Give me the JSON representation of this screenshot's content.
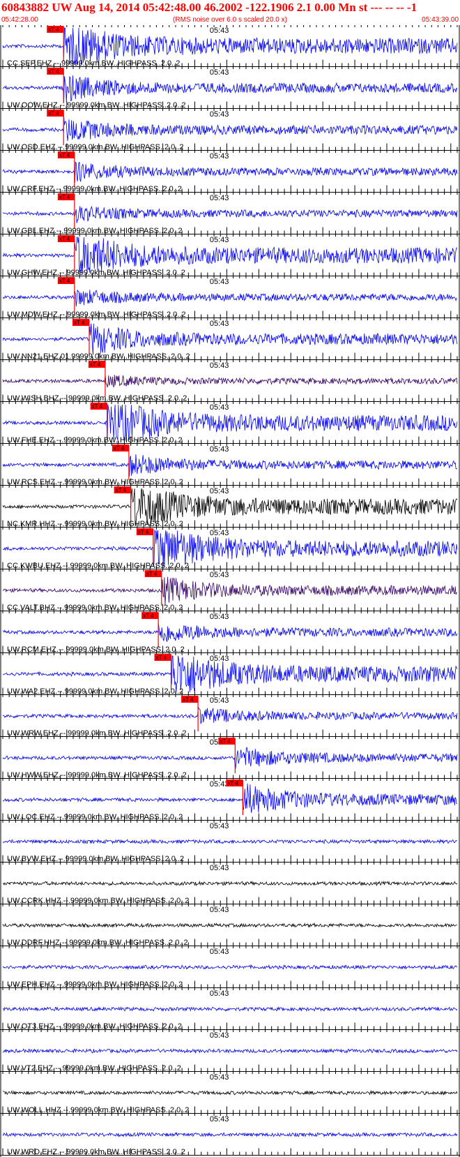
{
  "header": {
    "title": "60843882 UW Aug 14, 2014 05:42:48.00   46.2002 -122.1906  2.1 0.00 Mn st --- -- --  -1",
    "start_time": "05:42:28.00",
    "note": "(RMS noise over 6.0 s scaled 20.0 x)",
    "end_time": "05:43:39.00"
  },
  "colors": {
    "header": "#ff0000",
    "ehz_trace": "#0000ff",
    "bhz_trace": "#330066",
    "hhz_trace": "#000000",
    "pick": "#ff0000",
    "axis": "#000000"
  },
  "chart_data": {
    "type": "line",
    "x_range": [
      "05:42:28.00",
      "05:43:39.00"
    ],
    "minute_mark": "05:43",
    "pick_label": "xT 4",
    "traces": [
      {
        "label": "CC.SEP.EHZ.--.99999.0km.BW..HIGHPASS..2.0..2",
        "channel": "EHZ",
        "pick": 9.5,
        "amp": 1.0
      },
      {
        "label": "UW.OOW.EHZ.--.99999.0km.BW..HIGHPASS..2.0..2",
        "channel": "EHZ",
        "pick": 9.5,
        "amp": 0.5
      },
      {
        "label": "UW.OSD.EHZ.--.99999.0km.BW..HIGHPASS..2.0..2",
        "channel": "EHZ",
        "pick": 9.5,
        "amp": 0.45
      },
      {
        "label": "UW.CRF.EHZ.--.99999.0km.BW..HIGHPASS..2.0..2",
        "channel": "EHZ",
        "pick": 11.2,
        "amp": 0.35
      },
      {
        "label": "UW.GBL.EHZ.--.99999.0km.BW..HIGHPASS..2.0..2",
        "channel": "EHZ",
        "pick": 11.2,
        "amp": 0.3
      },
      {
        "label": "UW.GHW.EHZ.--.99999.0km.BW..HIGHPASS..2.0..2",
        "channel": "EHZ",
        "pick": 11.2,
        "amp": 1.0
      },
      {
        "label": "UW.MDW.EHZ.--.99999.0km.BW..HIGHPASS..2.0..2",
        "channel": "EHZ",
        "pick": 11.2,
        "amp": 0.3
      },
      {
        "label": "UW.NN21.EHZ.01.99999.0km.BW..HIGHPASS..2.0..2",
        "channel": "EHZ",
        "pick": 13.5,
        "amp": 0.6
      },
      {
        "label": "UW.WISH.BHZ.--.99999.0km.BW..HIGHPASS..2.0..2",
        "channel": "BHZ",
        "pick": 16.0,
        "amp": 0.2
      },
      {
        "label": "UW.FHE.EHZ.--.99999.0km.BW..HIGHPASS..2.0..2",
        "channel": "EHZ",
        "pick": 16.3,
        "amp": 1.0
      },
      {
        "label": "UW.RCS.EHZ.--.99999.0km.BW..HIGHPASS..2.0..2",
        "channel": "EHZ",
        "pick": 19.7,
        "amp": 0.4
      },
      {
        "label": "NC.KMR.HHZ.--.99999.0km.BW..HIGHPASS..2.0..2",
        "channel": "HHZ",
        "pick": 20.0,
        "amp": 1.0
      },
      {
        "label": "CC.KWBU.EHZ.--.99999.0km.BW..HIGHPASS..2.0..2",
        "channel": "EHZ",
        "pick": 23.5,
        "amp": 1.0
      },
      {
        "label": "CC.VALT.BHZ.--.99999.0km.BW..HIGHPASS..2.0..2",
        "channel": "BHZ",
        "pick": 24.8,
        "amp": 0.5
      },
      {
        "label": "UW.RCM.EHZ.--.99999.0km.BW..HIGHPASS..2.0..2",
        "channel": "EHZ",
        "pick": 24.3,
        "amp": 0.4
      },
      {
        "label": "UW.WA2.EHZ.--.99999.0km.BW..HIGHPASS..2.0..2",
        "channel": "EHZ",
        "pick": 26.3,
        "amp": 1.0
      },
      {
        "label": "UW.WRW.EHZ.--.99999.0km.BW..HIGHPASS..2.0..2",
        "channel": "EHZ",
        "pick": 30.5,
        "amp": 0.3
      },
      {
        "label": "UW.HWW.EHZ.--.99999.0km.BW..HIGHPASS..2.0..2",
        "channel": "EHZ",
        "pick": 36.3,
        "amp": 0.4
      },
      {
        "label": "UW.LOC.EHZ.--.99999.0km.BW..HIGHPASS..2.0..2",
        "channel": "EHZ",
        "pick": 37.5,
        "amp": 0.6
      },
      {
        "label": "UW.BVW.EHZ.--.99999.0km.BW..HIGHPASS..2.0..2",
        "channel": "EHZ",
        "pick": null,
        "amp": 0.15
      },
      {
        "label": "UW.CCRK.HHZ.--.99999.0km.BW..HIGHPASS..2.0..2",
        "channel": "HHZ",
        "pick": null,
        "amp": 0.2
      },
      {
        "label": "UW.DDRF.HHZ.--.99999.0km.BW..HIGHPASS..2.0..2",
        "channel": "HHZ",
        "pick": null,
        "amp": 0.15
      },
      {
        "label": "UW.EPH.EHZ.--.99999.0km.BW..HIGHPASS..2.0..2",
        "channel": "EHZ",
        "pick": null,
        "amp": 0.15
      },
      {
        "label": "UW.OT3.EHZ.--.99999.0km.BW..HIGHPASS..2.0..2",
        "channel": "EHZ",
        "pick": null,
        "amp": 0.15
      },
      {
        "label": "UW.VT2.EHZ.--.99999.0km.BW..HIGHPASS..2.0..2",
        "channel": "EHZ",
        "pick": null,
        "amp": 0.12
      },
      {
        "label": "UW.WOLL.HHZ.--.99999.0km.BW..HIGHPASS..2.0..2",
        "channel": "HHZ",
        "pick": null,
        "amp": 0.15
      },
      {
        "label": "UW.WRD.EHZ.--.99999.0km.BW..HIGHPASS..2.0..2",
        "channel": "EHZ",
        "pick": null,
        "amp": 0.12
      }
    ]
  }
}
